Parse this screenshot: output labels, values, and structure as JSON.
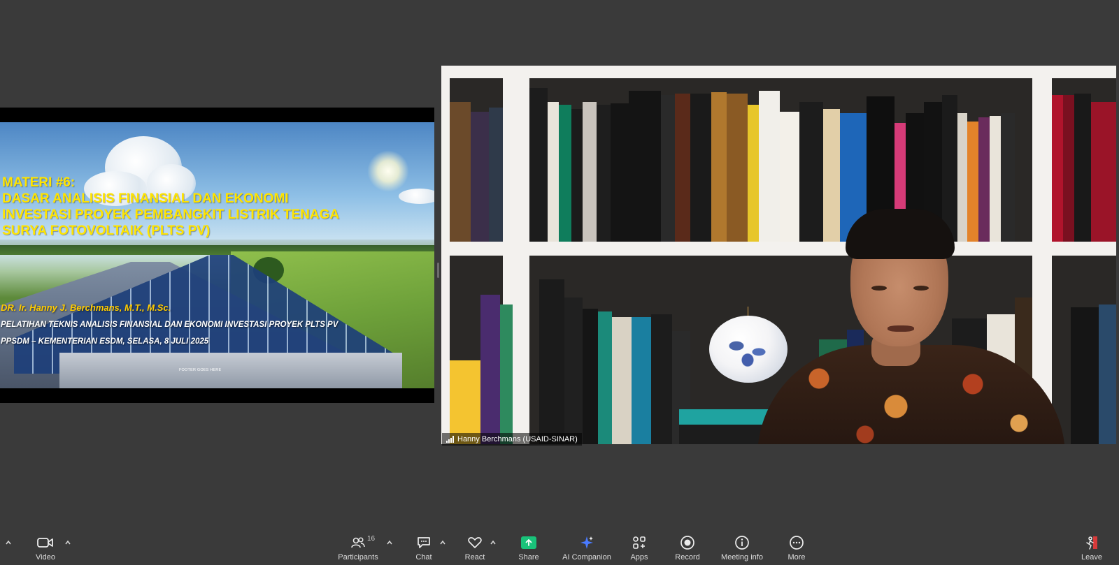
{
  "slide": {
    "title_lines": [
      "MATERI #6:",
      "DASAR ANALISIS FINANSIAL DAN EKONOMI",
      "INVESTASI PROYEK PEMBANGKIT LISTRIK TENAGA",
      "SURYA FOTOVOLTAIK (PLTS PV)"
    ],
    "author": "DR. Ir. Hanny J. Berchmans, M.T., M.Sc.",
    "subtitle_1": "PELATIHAN TEKNIS ANALISIS FINANSIAL DAN EKONOMI INVESTASI PROYEK PLTS PV",
    "subtitle_2": "PPSDM – KEMENTERIAN ESDM, SELASA, 8 JULI 2025",
    "footer": "FOOTER GOES HERE"
  },
  "video": {
    "participant_name": "Hanny Berchmans (USAID-SINAR)"
  },
  "toolbar": {
    "video_label": "Video",
    "participants_label": "Participants",
    "participants_count": "16",
    "chat_label": "Chat",
    "react_label": "React",
    "share_label": "Share",
    "ai_companion_label": "AI Companion",
    "apps_label": "Apps",
    "record_label": "Record",
    "meeting_info_label": "Meeting info",
    "more_label": "More",
    "leave_label": "Leave"
  },
  "colors": {
    "background": "#3a3a3a",
    "share_accent": "#19c27a",
    "title_yellow": "#ffe400"
  }
}
